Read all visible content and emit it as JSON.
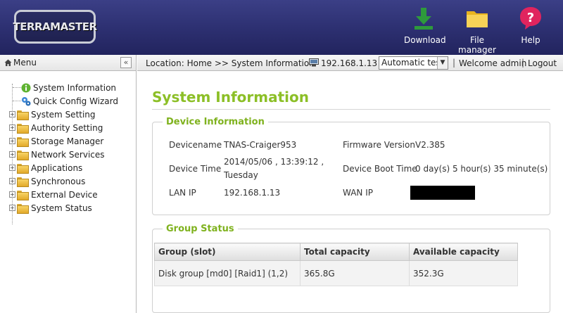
{
  "header": {
    "logo_text": "TERRAMASTER",
    "buttons": [
      {
        "label": "Download",
        "icon": "download-icon",
        "color": "#2e9a3c"
      },
      {
        "label": "File manager",
        "icon": "folder-icon",
        "color": "#f0c330"
      },
      {
        "label": "Help",
        "icon": "help-icon",
        "color": "#e0245e"
      }
    ]
  },
  "sidebar": {
    "title": "Menu",
    "collapse_label": "«",
    "items": [
      {
        "label": "System Information",
        "icon": "info-icon"
      },
      {
        "label": "Quick Config Wizard",
        "icon": "wizard-icon"
      },
      {
        "label": "System Setting",
        "icon": "folder-icon"
      },
      {
        "label": "Authority Setting",
        "icon": "folder-icon"
      },
      {
        "label": "Storage Manager",
        "icon": "folder-icon"
      },
      {
        "label": "Network Services",
        "icon": "folder-icon"
      },
      {
        "label": "Applications",
        "icon": "folder-icon"
      },
      {
        "label": "Synchronous",
        "icon": "folder-icon"
      },
      {
        "label": "External Device",
        "icon": "folder-icon"
      },
      {
        "label": "System Status",
        "icon": "folder-icon"
      }
    ]
  },
  "locbar": {
    "location": "Location: Home >> System Information",
    "ip": "192.168.1.13",
    "select_value": "Automatic test",
    "sep": "|",
    "welcome": "Welcome admin",
    "logout": "Logout"
  },
  "main": {
    "title": "System Information",
    "device": {
      "legend": "Device Information",
      "devicename_label": "Devicename",
      "devicename": "TNAS-Craiger953",
      "firmware_label": "Firmware Version",
      "firmware": "V2.385",
      "device_time_label": "Device Time",
      "device_time_line1": "2014/05/06 , 13:39:12 ,",
      "device_time_line2": "Tuesday",
      "boot_time_label": "Device Boot Time",
      "boot_time": "0 day(s) 5 hour(s) 35 minute(s)",
      "lan_ip_label": "LAN IP",
      "lan_ip": "192.168.1.13",
      "wan_ip_label": "WAN IP"
    },
    "group": {
      "legend": "Group Status",
      "headers": [
        "Group (slot)",
        "Total capacity",
        "Available capacity"
      ],
      "rows": [
        [
          "Disk group [md0] [Raid1] (1,2)",
          "365.8G",
          "352.3G"
        ]
      ]
    }
  },
  "colors": {
    "accent_green": "#8cbf27",
    "header_blue": "#2c2f70"
  }
}
